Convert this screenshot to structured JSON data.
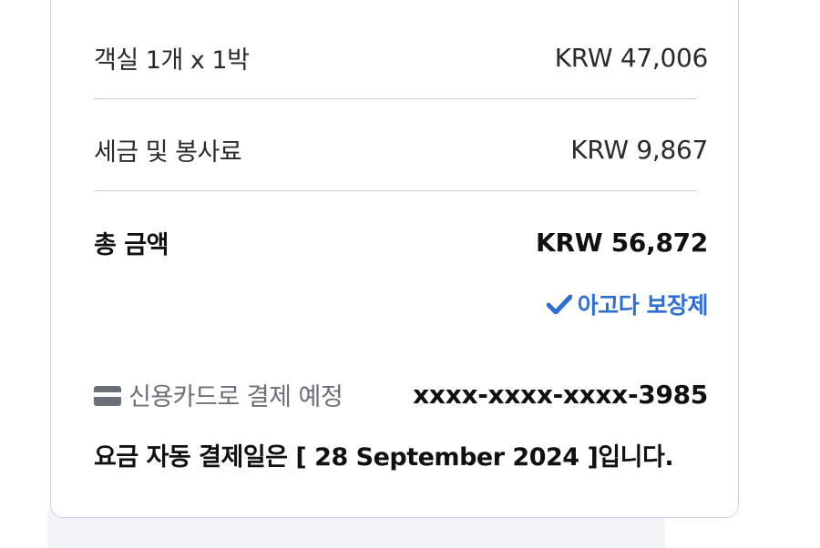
{
  "summary": {
    "rooms_label": "객실 1개 x 1박",
    "rooms_value": "KRW 47,006",
    "tax_label": "세금 및 봉사료",
    "tax_value": "KRW 9,867",
    "total_label": "총 금액",
    "total_value": "KRW 56,872",
    "guarantee_label": "아고다 보장제"
  },
  "payment": {
    "method_label": "신용카드로 결제 예정",
    "card_number": "xxxx-xxxx-xxxx-3985",
    "due_notice": "요금 자동 결제일은 [ 28 September 2024 ]입니다."
  },
  "colors": {
    "accent": "#2f6fd4",
    "divider": "#c8d0de",
    "card_border": "#c9d3e3"
  },
  "icons": {
    "guarantee": "checkmark-icon",
    "payment_method": "credit-card-icon"
  }
}
